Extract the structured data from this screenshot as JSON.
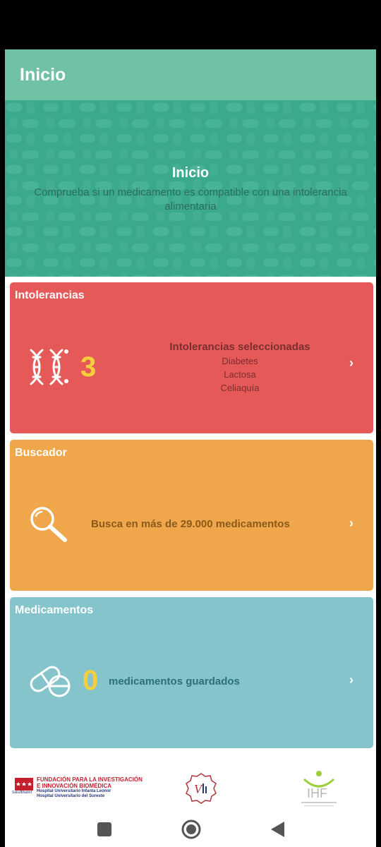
{
  "appbar": {
    "title": "Inicio"
  },
  "hero": {
    "title": "Inicio",
    "subtitle": "Comprueba si un medicamento es compatible con una intolerancia alimentaria"
  },
  "intolerancias": {
    "title": "Intolerancias",
    "count": "3",
    "heading": "Intolerancias seleccionadas",
    "items": [
      "Diabetes",
      "Lactosa",
      "Celiaquía"
    ],
    "icon": "dna-icon",
    "chevron": "›"
  },
  "buscador": {
    "title": "Buscador",
    "text": "Busca en más de 29.000 medicamentos",
    "icon": "magnifier-icon",
    "chevron": "›"
  },
  "medicamentos": {
    "title": "Medicamentos",
    "count": "0",
    "text": "medicamentos guardados",
    "icon": "pills-icon",
    "chevron": "›"
  },
  "footer": {
    "logo1_line1": "FUNDACIÓN PARA LA INVESTIGACIÓN",
    "logo1_line2": "E INNOVACIÓN BIOMÉDICA",
    "logo1_line3": "Hospital Universitario Infanta Leonor",
    "logo1_line4": "Hospital Universitario del Sureste",
    "logo1_brand": "SaludMadrid",
    "logo3_text": "IHF"
  },
  "colors": {
    "appbar": "#6fc2a3",
    "red_card": "#e55a58",
    "orange_card": "#f0a64a",
    "blue_card": "#86c4cc",
    "accent_number": "#f4cf3c"
  }
}
